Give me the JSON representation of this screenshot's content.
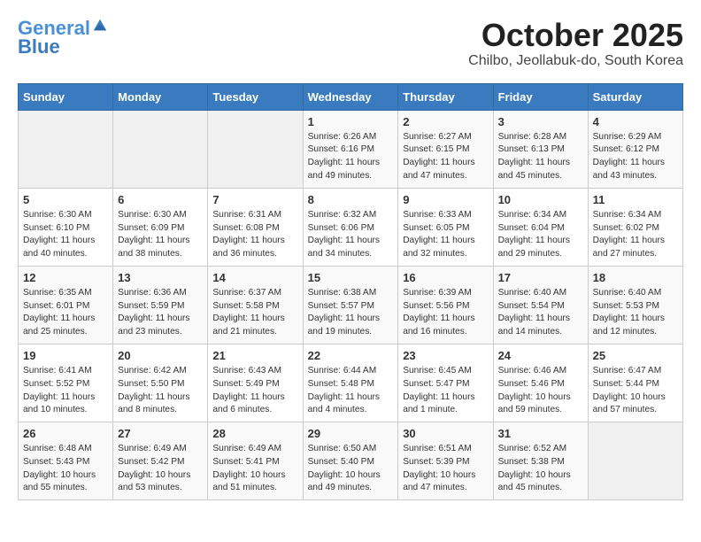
{
  "header": {
    "logo_line1": "General",
    "logo_line2": "Blue",
    "month_title": "October 2025",
    "location": "Chilbo, Jeollabuk-do, South Korea"
  },
  "weekdays": [
    "Sunday",
    "Monday",
    "Tuesday",
    "Wednesday",
    "Thursday",
    "Friday",
    "Saturday"
  ],
  "weeks": [
    [
      {
        "day": "",
        "info": ""
      },
      {
        "day": "",
        "info": ""
      },
      {
        "day": "",
        "info": ""
      },
      {
        "day": "1",
        "info": "Sunrise: 6:26 AM\nSunset: 6:16 PM\nDaylight: 11 hours\nand 49 minutes."
      },
      {
        "day": "2",
        "info": "Sunrise: 6:27 AM\nSunset: 6:15 PM\nDaylight: 11 hours\nand 47 minutes."
      },
      {
        "day": "3",
        "info": "Sunrise: 6:28 AM\nSunset: 6:13 PM\nDaylight: 11 hours\nand 45 minutes."
      },
      {
        "day": "4",
        "info": "Sunrise: 6:29 AM\nSunset: 6:12 PM\nDaylight: 11 hours\nand 43 minutes."
      }
    ],
    [
      {
        "day": "5",
        "info": "Sunrise: 6:30 AM\nSunset: 6:10 PM\nDaylight: 11 hours\nand 40 minutes."
      },
      {
        "day": "6",
        "info": "Sunrise: 6:30 AM\nSunset: 6:09 PM\nDaylight: 11 hours\nand 38 minutes."
      },
      {
        "day": "7",
        "info": "Sunrise: 6:31 AM\nSunset: 6:08 PM\nDaylight: 11 hours\nand 36 minutes."
      },
      {
        "day": "8",
        "info": "Sunrise: 6:32 AM\nSunset: 6:06 PM\nDaylight: 11 hours\nand 34 minutes."
      },
      {
        "day": "9",
        "info": "Sunrise: 6:33 AM\nSunset: 6:05 PM\nDaylight: 11 hours\nand 32 minutes."
      },
      {
        "day": "10",
        "info": "Sunrise: 6:34 AM\nSunset: 6:04 PM\nDaylight: 11 hours\nand 29 minutes."
      },
      {
        "day": "11",
        "info": "Sunrise: 6:34 AM\nSunset: 6:02 PM\nDaylight: 11 hours\nand 27 minutes."
      }
    ],
    [
      {
        "day": "12",
        "info": "Sunrise: 6:35 AM\nSunset: 6:01 PM\nDaylight: 11 hours\nand 25 minutes."
      },
      {
        "day": "13",
        "info": "Sunrise: 6:36 AM\nSunset: 5:59 PM\nDaylight: 11 hours\nand 23 minutes."
      },
      {
        "day": "14",
        "info": "Sunrise: 6:37 AM\nSunset: 5:58 PM\nDaylight: 11 hours\nand 21 minutes."
      },
      {
        "day": "15",
        "info": "Sunrise: 6:38 AM\nSunset: 5:57 PM\nDaylight: 11 hours\nand 19 minutes."
      },
      {
        "day": "16",
        "info": "Sunrise: 6:39 AM\nSunset: 5:56 PM\nDaylight: 11 hours\nand 16 minutes."
      },
      {
        "day": "17",
        "info": "Sunrise: 6:40 AM\nSunset: 5:54 PM\nDaylight: 11 hours\nand 14 minutes."
      },
      {
        "day": "18",
        "info": "Sunrise: 6:40 AM\nSunset: 5:53 PM\nDaylight: 11 hours\nand 12 minutes."
      }
    ],
    [
      {
        "day": "19",
        "info": "Sunrise: 6:41 AM\nSunset: 5:52 PM\nDaylight: 11 hours\nand 10 minutes."
      },
      {
        "day": "20",
        "info": "Sunrise: 6:42 AM\nSunset: 5:50 PM\nDaylight: 11 hours\nand 8 minutes."
      },
      {
        "day": "21",
        "info": "Sunrise: 6:43 AM\nSunset: 5:49 PM\nDaylight: 11 hours\nand 6 minutes."
      },
      {
        "day": "22",
        "info": "Sunrise: 6:44 AM\nSunset: 5:48 PM\nDaylight: 11 hours\nand 4 minutes."
      },
      {
        "day": "23",
        "info": "Sunrise: 6:45 AM\nSunset: 5:47 PM\nDaylight: 11 hours\nand 1 minute."
      },
      {
        "day": "24",
        "info": "Sunrise: 6:46 AM\nSunset: 5:46 PM\nDaylight: 10 hours\nand 59 minutes."
      },
      {
        "day": "25",
        "info": "Sunrise: 6:47 AM\nSunset: 5:44 PM\nDaylight: 10 hours\nand 57 minutes."
      }
    ],
    [
      {
        "day": "26",
        "info": "Sunrise: 6:48 AM\nSunset: 5:43 PM\nDaylight: 10 hours\nand 55 minutes."
      },
      {
        "day": "27",
        "info": "Sunrise: 6:49 AM\nSunset: 5:42 PM\nDaylight: 10 hours\nand 53 minutes."
      },
      {
        "day": "28",
        "info": "Sunrise: 6:49 AM\nSunset: 5:41 PM\nDaylight: 10 hours\nand 51 minutes."
      },
      {
        "day": "29",
        "info": "Sunrise: 6:50 AM\nSunset: 5:40 PM\nDaylight: 10 hours\nand 49 minutes."
      },
      {
        "day": "30",
        "info": "Sunrise: 6:51 AM\nSunset: 5:39 PM\nDaylight: 10 hours\nand 47 minutes."
      },
      {
        "day": "31",
        "info": "Sunrise: 6:52 AM\nSunset: 5:38 PM\nDaylight: 10 hours\nand 45 minutes."
      },
      {
        "day": "",
        "info": ""
      }
    ]
  ]
}
